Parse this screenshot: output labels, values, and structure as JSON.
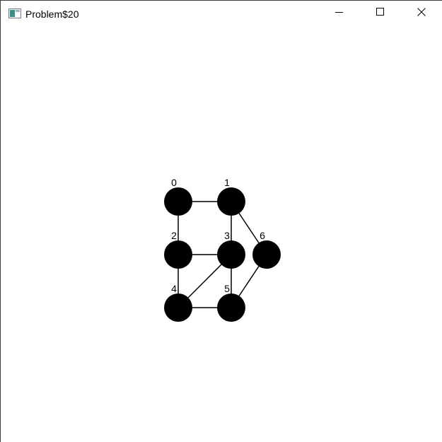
{
  "window": {
    "title": "Problem$20",
    "app_icon": "window-app-icon",
    "controls": {
      "minimize_icon": "minimize-icon",
      "maximize_icon": "maximize-icon",
      "close_icon": "close-icon"
    }
  },
  "graph": {
    "node_color": "#000000",
    "edge_color": "#000000",
    "nodes": [
      {
        "id": 0,
        "label": "0"
      },
      {
        "id": 1,
        "label": "1"
      },
      {
        "id": 2,
        "label": "2"
      },
      {
        "id": 3,
        "label": "3"
      },
      {
        "id": 4,
        "label": "4"
      },
      {
        "id": 5,
        "label": "5"
      },
      {
        "id": 6,
        "label": "6"
      }
    ],
    "edges": [
      [
        0,
        1
      ],
      [
        0,
        2
      ],
      [
        1,
        3
      ],
      [
        1,
        6
      ],
      [
        2,
        3
      ],
      [
        2,
        4
      ],
      [
        3,
        4
      ],
      [
        3,
        5
      ],
      [
        4,
        5
      ],
      [
        5,
        6
      ]
    ]
  }
}
